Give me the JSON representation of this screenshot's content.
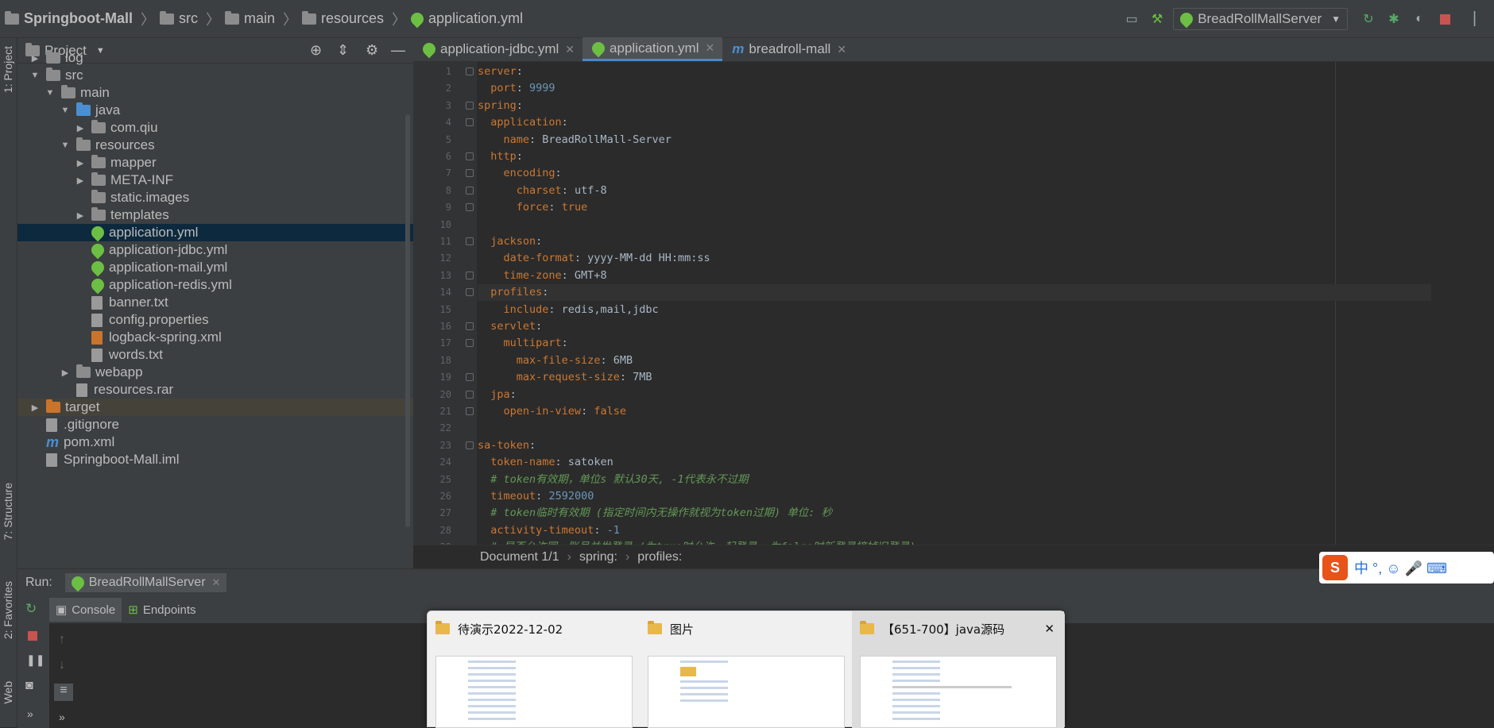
{
  "breadcrumb": {
    "project": "Springboot-Mall",
    "items": [
      "src",
      "main",
      "resources",
      "application.yml"
    ]
  },
  "toolbar": {
    "run_config": "BreadRollMallServer",
    "icons": [
      "rerun-icon",
      "debug-icon",
      "coverage-icon",
      "stop-icon"
    ]
  },
  "left_strip": {
    "project_label": "1: Project",
    "structure_label": "7: Structure",
    "favorites_label": "2: Favorites",
    "web_label": "Web"
  },
  "project": {
    "title": "Project",
    "tree": [
      {
        "label": "log",
        "depth": 1,
        "arrow": "right",
        "icon": "folder"
      },
      {
        "label": "src",
        "depth": 1,
        "arrow": "down",
        "icon": "folder"
      },
      {
        "label": "main",
        "depth": 2,
        "arrow": "down",
        "icon": "folder"
      },
      {
        "label": "java",
        "depth": 3,
        "arrow": "down",
        "icon": "folder-blue"
      },
      {
        "label": "com.qiu",
        "depth": 4,
        "arrow": "right",
        "icon": "package"
      },
      {
        "label": "resources",
        "depth": 3,
        "arrow": "down",
        "icon": "folder-res"
      },
      {
        "label": "mapper",
        "depth": 4,
        "arrow": "right",
        "icon": "folder"
      },
      {
        "label": "META-INF",
        "depth": 4,
        "arrow": "right",
        "icon": "folder"
      },
      {
        "label": "static.images",
        "depth": 4,
        "arrow": "",
        "icon": "folder"
      },
      {
        "label": "templates",
        "depth": 4,
        "arrow": "right",
        "icon": "folder"
      },
      {
        "label": "application.yml",
        "depth": 4,
        "arrow": "",
        "icon": "spring",
        "selected": true
      },
      {
        "label": "application-jdbc.yml",
        "depth": 4,
        "arrow": "",
        "icon": "spring"
      },
      {
        "label": "application-mail.yml",
        "depth": 4,
        "arrow": "",
        "icon": "spring"
      },
      {
        "label": "application-redis.yml",
        "depth": 4,
        "arrow": "",
        "icon": "spring"
      },
      {
        "label": "banner.txt",
        "depth": 4,
        "arrow": "",
        "icon": "file"
      },
      {
        "label": "config.properties",
        "depth": 4,
        "arrow": "",
        "icon": "file"
      },
      {
        "label": "logback-spring.xml",
        "depth": 4,
        "arrow": "",
        "icon": "xml"
      },
      {
        "label": "words.txt",
        "depth": 4,
        "arrow": "",
        "icon": "file"
      },
      {
        "label": "webapp",
        "depth": 3,
        "arrow": "right",
        "icon": "folder"
      },
      {
        "label": "resources.rar",
        "depth": 3,
        "arrow": "",
        "icon": "file"
      },
      {
        "label": "target",
        "depth": 1,
        "arrow": "right",
        "icon": "folder-orange",
        "target": true
      },
      {
        "label": ".gitignore",
        "depth": 1,
        "arrow": "",
        "icon": "file"
      },
      {
        "label": "pom.xml",
        "depth": 1,
        "arrow": "",
        "icon": "maven"
      },
      {
        "label": "Springboot-Mall.iml",
        "depth": 1,
        "arrow": "",
        "icon": "file"
      }
    ]
  },
  "editor": {
    "tabs": [
      {
        "label": "application-jdbc.yml",
        "active": false
      },
      {
        "label": "application.yml",
        "active": true
      },
      {
        "label": "breadroll-mall",
        "active": false
      }
    ],
    "lines": [
      [
        [
          "k",
          "server"
        ],
        [
          "s",
          ":"
        ]
      ],
      [
        [
          "s",
          "  "
        ],
        [
          "k",
          "port"
        ],
        [
          "s",
          ": "
        ],
        [
          "n",
          "9999"
        ]
      ],
      [
        [
          "k",
          "spring"
        ],
        [
          "s",
          ":"
        ]
      ],
      [
        [
          "s",
          "  "
        ],
        [
          "k",
          "application"
        ],
        [
          "s",
          ":"
        ]
      ],
      [
        [
          "s",
          "    "
        ],
        [
          "k",
          "name"
        ],
        [
          "s",
          ": BreadRollMall-Server"
        ]
      ],
      [
        [
          "s",
          "  "
        ],
        [
          "k",
          "http"
        ],
        [
          "s",
          ":"
        ]
      ],
      [
        [
          "s",
          "    "
        ],
        [
          "k",
          "encoding"
        ],
        [
          "s",
          ":"
        ]
      ],
      [
        [
          "s",
          "      "
        ],
        [
          "k",
          "charset"
        ],
        [
          "s",
          ": utf-8"
        ]
      ],
      [
        [
          "s",
          "      "
        ],
        [
          "k",
          "force"
        ],
        [
          "s",
          ": "
        ],
        [
          "k",
          "true"
        ]
      ],
      [],
      [
        [
          "s",
          "  "
        ],
        [
          "k",
          "jackson"
        ],
        [
          "s",
          ":"
        ]
      ],
      [
        [
          "s",
          "    "
        ],
        [
          "k",
          "date-format"
        ],
        [
          "s",
          ": yyyy-MM-dd HH:mm:ss"
        ]
      ],
      [
        [
          "s",
          "    "
        ],
        [
          "k",
          "time-zone"
        ],
        [
          "s",
          ": GMT+8"
        ]
      ],
      [
        [
          "s",
          "  "
        ],
        [
          "k",
          "profiles"
        ],
        [
          "s",
          ":"
        ]
      ],
      [
        [
          "s",
          "    "
        ],
        [
          "k",
          "include"
        ],
        [
          "s",
          ": redis,mail,jdbc"
        ]
      ],
      [
        [
          "s",
          "  "
        ],
        [
          "k",
          "servlet"
        ],
        [
          "s",
          ":"
        ]
      ],
      [
        [
          "s",
          "    "
        ],
        [
          "k",
          "multipart"
        ],
        [
          "s",
          ":"
        ]
      ],
      [
        [
          "s",
          "      "
        ],
        [
          "k",
          "max-file-size"
        ],
        [
          "s",
          ": 6MB"
        ]
      ],
      [
        [
          "s",
          "      "
        ],
        [
          "k",
          "max-request-size"
        ],
        [
          "s",
          ": 7MB"
        ]
      ],
      [
        [
          "s",
          "  "
        ],
        [
          "k",
          "jpa"
        ],
        [
          "s",
          ":"
        ]
      ],
      [
        [
          "s",
          "    "
        ],
        [
          "k",
          "open-in-view"
        ],
        [
          "s",
          ": "
        ],
        [
          "k",
          "false"
        ]
      ],
      [],
      [
        [
          "k",
          "sa-token"
        ],
        [
          "s",
          ":"
        ]
      ],
      [
        [
          "s",
          "  "
        ],
        [
          "k",
          "token-name"
        ],
        [
          "s",
          ": satoken"
        ]
      ],
      [
        [
          "s",
          "  "
        ],
        [
          "c",
          "# token有效期，单位s 默认30天, -1代表永不过期"
        ]
      ],
      [
        [
          "s",
          "  "
        ],
        [
          "k",
          "timeout"
        ],
        [
          "s",
          ": "
        ],
        [
          "n",
          "2592000"
        ]
      ],
      [
        [
          "s",
          "  "
        ],
        [
          "c",
          "# token临时有效期 (指定时间内无操作就视为token过期) 单位: 秒"
        ]
      ],
      [
        [
          "s",
          "  "
        ],
        [
          "k",
          "activity-timeout"
        ],
        [
          "s",
          ": "
        ],
        [
          "n",
          "-1"
        ]
      ],
      [
        [
          "s",
          "  "
        ],
        [
          "c",
          "# 是否允许同一账号并发登录 (为true时允许一起登录, 为false时新登录挤掉旧登录)"
        ]
      ]
    ],
    "current_line": 14,
    "status": [
      "Document 1/1",
      "spring:",
      "profiles:"
    ]
  },
  "run": {
    "label": "Run:",
    "config": "BreadRollMallServer",
    "tabs": [
      "Console",
      "Endpoints"
    ]
  },
  "taskbar_popup": {
    "items": [
      {
        "title": "待演示2022-12-02"
      },
      {
        "title": "图片"
      },
      {
        "title": "【651-700】java源码"
      }
    ],
    "close": "✕"
  },
  "ime": {
    "label": "中 °, ☺ 🎤 ⌨"
  }
}
